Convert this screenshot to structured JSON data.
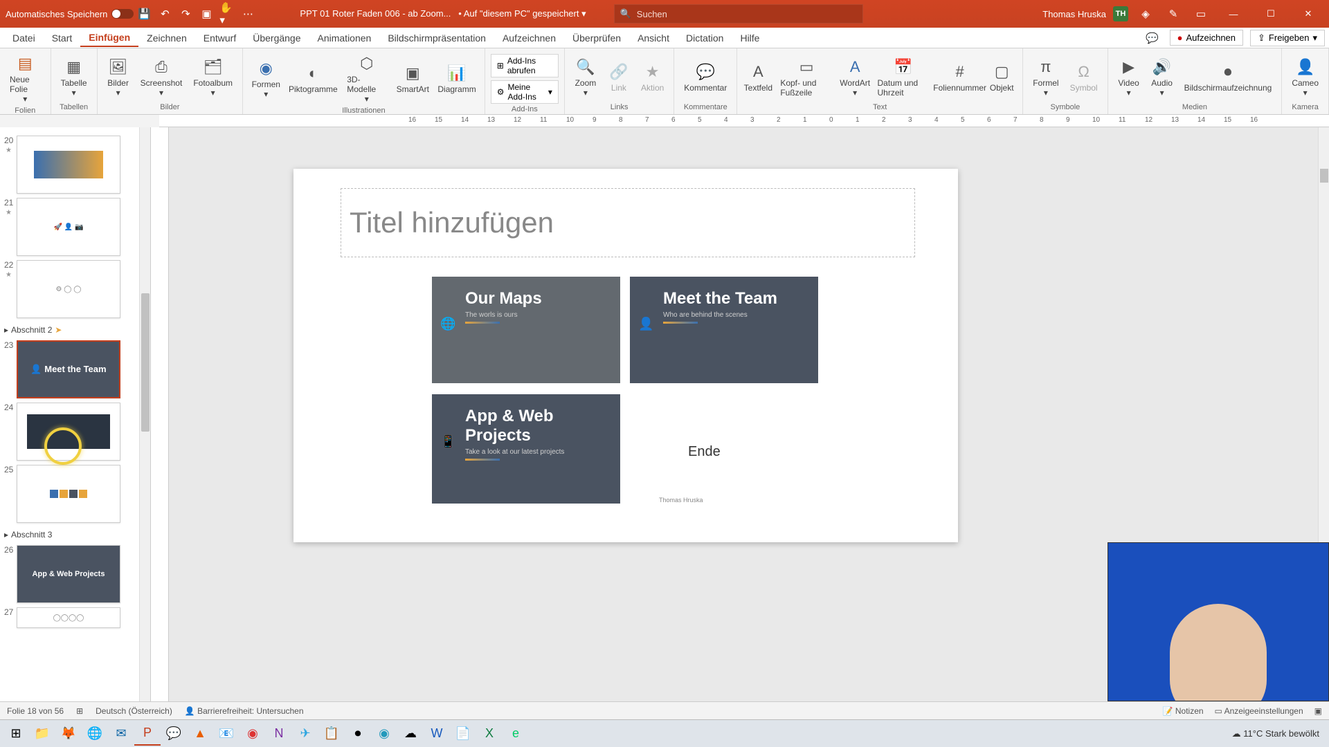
{
  "titlebar": {
    "autosave_label": "Automatisches Speichern",
    "filename": "PPT 01 Roter Faden 006 - ab Zoom...",
    "saved_hint": "• Auf \"diesem PC\" gespeichert",
    "search_placeholder": "Suchen",
    "user_name": "Thomas Hruska",
    "user_initials": "TH"
  },
  "menu": {
    "items": [
      "Datei",
      "Start",
      "Einfügen",
      "Zeichnen",
      "Entwurf",
      "Übergänge",
      "Animationen",
      "Bildschirmpräsentation",
      "Aufzeichnen",
      "Überprüfen",
      "Ansicht",
      "Dictation",
      "Hilfe"
    ],
    "active_index": 2,
    "record": "Aufzeichnen",
    "share": "Freigeben"
  },
  "ribbon": {
    "groups": {
      "folien": {
        "label": "Folien",
        "tools": [
          {
            "label": "Neue Folie"
          }
        ]
      },
      "tabellen": {
        "label": "Tabellen",
        "tools": [
          {
            "label": "Tabelle"
          }
        ]
      },
      "bilder": {
        "label": "Bilder",
        "tools": [
          {
            "label": "Bilder"
          },
          {
            "label": "Screenshot"
          },
          {
            "label": "Fotoalbum"
          }
        ]
      },
      "illustrationen": {
        "label": "Illustrationen",
        "tools": [
          {
            "label": "Formen"
          },
          {
            "label": "Piktogramme"
          },
          {
            "label": "3D-Modelle"
          },
          {
            "label": "SmartArt"
          },
          {
            "label": "Diagramm"
          }
        ]
      },
      "addins": {
        "label": "Add-Ins",
        "get": "Add-Ins abrufen",
        "my": "Meine Add-Ins"
      },
      "links": {
        "label": "Links",
        "tools": [
          {
            "label": "Zoom"
          },
          {
            "label": "Link"
          },
          {
            "label": "Aktion"
          }
        ]
      },
      "kommentar": {
        "label": "Kommentare",
        "tools": [
          {
            "label": "Kommentar"
          }
        ]
      },
      "text": {
        "label": "Text",
        "tools": [
          {
            "label": "Textfeld"
          },
          {
            "label": "Kopf- und Fußzeile"
          },
          {
            "label": "WordArt"
          },
          {
            "label": "Datum und Uhrzeit"
          },
          {
            "label": "Foliennummer"
          },
          {
            "label": "Objekt"
          }
        ]
      },
      "symbole": {
        "label": "Symbole",
        "tools": [
          {
            "label": "Formel"
          },
          {
            "label": "Symbol"
          }
        ]
      },
      "medien": {
        "label": "Medien",
        "tools": [
          {
            "label": "Video"
          },
          {
            "label": "Audio"
          },
          {
            "label": "Bildschirmaufzeichnung"
          }
        ]
      },
      "kamera": {
        "label": "Kamera",
        "tools": [
          {
            "label": "Cameo"
          }
        ]
      }
    }
  },
  "ruler": {
    "marks": [
      "16",
      "15",
      "14",
      "13",
      "12",
      "11",
      "10",
      "9",
      "8",
      "7",
      "6",
      "5",
      "4",
      "3",
      "2",
      "1",
      "0",
      "1",
      "2",
      "3",
      "4",
      "5",
      "6",
      "7",
      "8",
      "9",
      "10",
      "11",
      "12",
      "13",
      "14",
      "15",
      "16"
    ]
  },
  "slidepanel": {
    "slides": [
      {
        "num": "20",
        "seq": true
      },
      {
        "num": "21",
        "seq": true
      },
      {
        "num": "22",
        "seq": true
      }
    ],
    "section2": "Abschnitt 2",
    "slides2": [
      {
        "num": "23",
        "dark": true,
        "label": "Meet the Team",
        "sel": true
      },
      {
        "num": "24"
      },
      {
        "num": "25"
      }
    ],
    "section3": "Abschnitt 3",
    "slides3": [
      {
        "num": "26",
        "dark": true,
        "label": "App & Web Projects"
      },
      {
        "num": "27"
      }
    ]
  },
  "slide": {
    "title_placeholder": "Titel hinzufügen",
    "tiles": {
      "maps": {
        "title": "Our Maps",
        "sub": "The worls is ours"
      },
      "team": {
        "title": "Meet the Team",
        "sub": "Who are behind the scenes"
      },
      "app": {
        "title": "App & Web Projects",
        "sub": "Take a look at our latest projects"
      }
    },
    "end": "Ende",
    "signer": "Thomas Hruska"
  },
  "statusbar": {
    "slide": "Folie 18 von 56",
    "lang": "Deutsch (Österreich)",
    "access": "Barrierefreiheit: Untersuchen",
    "notes": "Notizen",
    "display": "Anzeigeeinstellungen"
  },
  "taskbar": {
    "weather": "11°C  Stark bewölkt"
  }
}
